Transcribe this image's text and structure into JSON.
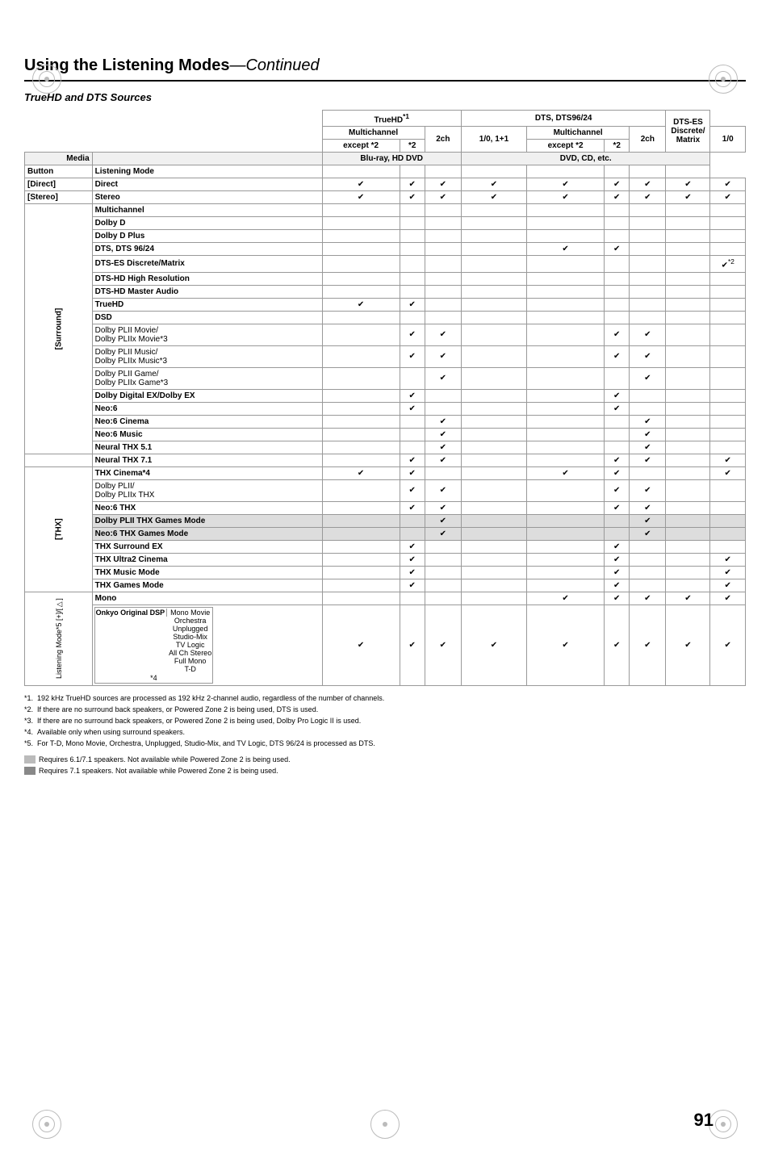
{
  "title": "Using the Listening Modes",
  "title_continued": "—Continued",
  "section_title": "TrueHD and DTS Sources",
  "page_number": "91",
  "table": {
    "col_groups": [
      {
        "label": "",
        "colspan": 2
      },
      {
        "label": "TrueHD*1",
        "colspan": 3
      },
      {
        "label": "DTS, DTS96/24",
        "colspan": 4
      },
      {
        "label": "DTS-ES Discrete/ Matrix",
        "colspan": 1
      }
    ],
    "sub_col_groups": [
      {
        "label": "",
        "colspan": 2
      },
      {
        "label": "Multichannel",
        "colspan": 2
      },
      {
        "label": "2ch",
        "colspan": 1
      },
      {
        "label": "1/0, 1+1",
        "colspan": 1
      },
      {
        "label": "Multichannel",
        "colspan": 2
      },
      {
        "label": "2ch",
        "colspan": 1
      },
      {
        "label": "1/0",
        "colspan": 1
      },
      {
        "label": "",
        "colspan": 1
      }
    ],
    "sub_sub_cols": [
      {
        "label": "except *2"
      },
      {
        "label": "*2"
      },
      {
        "label": "2ch"
      },
      {
        "label": "1/0, 1+1"
      },
      {
        "label": "except *2"
      },
      {
        "label": "*2"
      },
      {
        "label": "2ch"
      },
      {
        "label": "1/0"
      },
      {
        "label": ""
      }
    ],
    "media_row": [
      {
        "label": "Media",
        "align": "right"
      },
      {
        "label": "Blu-ray, HD DVD",
        "colspan": 3
      },
      {
        "label": "DVD, CD, etc.",
        "colspan": 5
      }
    ],
    "header_row": [
      {
        "label": "Button"
      },
      {
        "label": "Listening Mode"
      }
    ],
    "rows": [
      {
        "button": "[Direct]",
        "mode": "Direct",
        "group": "",
        "checks": [
          "✔",
          "✔",
          "✔",
          "✔",
          "✔",
          "✔",
          "✔",
          "✔",
          "✔"
        ]
      },
      {
        "button": "[Stereo]",
        "mode": "Stereo",
        "group": "",
        "checks": [
          "✔",
          "✔",
          "✔",
          "✔",
          "✔",
          "✔",
          "✔",
          "✔",
          "✔"
        ]
      },
      {
        "button": "",
        "mode": "Multichannel",
        "group": "[Surround]",
        "checks": [
          "",
          "",
          "",
          "",
          "",
          "",
          "",
          "",
          ""
        ]
      },
      {
        "button": "",
        "mode": "Dolby D",
        "group": "",
        "checks": [
          "",
          "",
          "",
          "",
          "",
          "",
          "",
          "",
          ""
        ]
      },
      {
        "button": "",
        "mode": "Dolby D Plus",
        "group": "",
        "checks": [
          "",
          "",
          "",
          "",
          "",
          "",
          "",
          "",
          ""
        ]
      },
      {
        "button": "",
        "mode": "DTS, DTS 96/24",
        "group": "",
        "checks": [
          "",
          "",
          "",
          "",
          "✔",
          "✔",
          "",
          "",
          ""
        ]
      },
      {
        "button": "",
        "mode": "DTS-ES Discrete/Matrix",
        "group": "",
        "checks": [
          "",
          "",
          "",
          "",
          "",
          "",
          "",
          "",
          "✔*2"
        ]
      },
      {
        "button": "",
        "mode": "DTS-HD High Resolution",
        "group": "",
        "checks": [
          "",
          "",
          "",
          "",
          "",
          "",
          "",
          "",
          ""
        ]
      },
      {
        "button": "",
        "mode": "DTS-HD Master Audio",
        "group": "",
        "checks": [
          "",
          "",
          "",
          "",
          "",
          "",
          "",
          "",
          ""
        ]
      },
      {
        "button": "",
        "mode": "TrueHD",
        "group": "",
        "checks": [
          "✔",
          "✔",
          "",
          "",
          "",
          "",
          "",
          "",
          ""
        ]
      },
      {
        "button": "",
        "mode": "DSD",
        "group": "",
        "checks": [
          "",
          "",
          "",
          "",
          "",
          "",
          "",
          "",
          ""
        ]
      },
      {
        "button": "",
        "mode": "Dolby PLII Movie/ Dolby PLIIx Movie*3",
        "group": "",
        "checks": [
          "",
          "✔",
          "✔",
          "",
          "",
          "✔",
          "✔",
          "",
          ""
        ]
      },
      {
        "button": "",
        "mode": "Dolby PLII Music/ Dolby PLIIx Music*3",
        "group": "",
        "checks": [
          "",
          "✔",
          "✔",
          "",
          "",
          "✔",
          "✔",
          "",
          ""
        ]
      },
      {
        "button": "",
        "mode": "Dolby PLII Game/ Dolby PLIIx Game*3",
        "group": "",
        "checks": [
          "",
          "",
          "✔",
          "",
          "",
          "",
          "✔",
          "",
          ""
        ]
      },
      {
        "button": "",
        "mode": "Dolby Digital EX/Dolby EX",
        "group": "",
        "checks": [
          "",
          "✔",
          "",
          "",
          "",
          "✔",
          "",
          "",
          ""
        ]
      },
      {
        "button": "",
        "mode": "Neo:6",
        "group": "",
        "checks": [
          "",
          "✔",
          "",
          "",
          "",
          "✔",
          "",
          "",
          ""
        ]
      },
      {
        "button": "",
        "mode": "Neo:6 Cinema",
        "group": "",
        "checks": [
          "",
          "",
          "✔",
          "",
          "",
          "",
          "✔",
          "",
          ""
        ]
      },
      {
        "button": "",
        "mode": "Neo:6 Music",
        "group": "",
        "checks": [
          "",
          "",
          "✔",
          "",
          "",
          "",
          "✔",
          "",
          ""
        ]
      },
      {
        "button": "",
        "mode": "Neural THX 5.1",
        "group": "",
        "checks": [
          "",
          "",
          "✔",
          "",
          "",
          "",
          "✔",
          "",
          ""
        ]
      },
      {
        "button": "",
        "mode": "Neural THX 7.1",
        "group": "",
        "checks": [
          "",
          "✔",
          "✔",
          "",
          "",
          "✔",
          "✔",
          "",
          "✔"
        ]
      },
      {
        "button": "",
        "mode": "THX Cinema*4",
        "group": "[THX]",
        "checks": [
          "✔",
          "✔",
          "",
          "",
          "✔",
          "✔",
          "",
          "",
          "✔"
        ]
      },
      {
        "button": "",
        "mode": "Dolby PLII/ Dolby PLIIx THX",
        "group": "",
        "checks": [
          "",
          "✔",
          "✔",
          "",
          "",
          "✔",
          "✔",
          "",
          ""
        ]
      },
      {
        "button": "",
        "mode": "Neo:6 THX",
        "group": "",
        "checks": [
          "",
          "✔",
          "✔",
          "",
          "",
          "✔",
          "✔",
          "",
          ""
        ]
      },
      {
        "button": "",
        "mode": "Dolby PLII THX Games Mode",
        "group": "",
        "checks": [
          "",
          "",
          "✔",
          "",
          "",
          "",
          "✔",
          "",
          ""
        ]
      },
      {
        "button": "",
        "mode": "Neo:6 THX Games Mode",
        "group": "",
        "checks": [
          "",
          "",
          "✔",
          "",
          "",
          "",
          "✔",
          "",
          ""
        ]
      },
      {
        "button": "",
        "mode": "THX Surround EX",
        "group": "",
        "checks": [
          "",
          "✔",
          "",
          "",
          "",
          "✔",
          "",
          "",
          ""
        ]
      },
      {
        "button": "",
        "mode": "THX Ultra2 Cinema",
        "group": "",
        "checks": [
          "",
          "✔",
          "",
          "",
          "",
          "✔",
          "",
          "",
          "✔"
        ]
      },
      {
        "button": "",
        "mode": "THX Music Mode",
        "group": "",
        "checks": [
          "",
          "✔",
          "",
          "",
          "",
          "✔",
          "",
          "",
          "✔"
        ]
      },
      {
        "button": "",
        "mode": "THX Games Mode",
        "group": "",
        "checks": [
          "",
          "✔",
          "",
          "",
          "",
          "✔",
          "",
          "",
          "✔"
        ]
      },
      {
        "button": "",
        "mode": "Mono",
        "group": "Listening Mode*5 [+]/[▷]",
        "checks": [
          "",
          "",
          "",
          "",
          "✔",
          "✔",
          "✔",
          "✔",
          "✔"
        ]
      },
      {
        "button": "",
        "mode": "Mono Movie / Orchestra / Unplugged / Studio-Mix / TV Logic / All Ch Stereo / Full Mono / T-D",
        "group": "",
        "checks": [
          "✔",
          "✔",
          "✔",
          "✔",
          "✔",
          "✔",
          "✔",
          "✔",
          "✔"
        ]
      }
    ]
  },
  "footnotes": [
    "*1.  192 kHz TrueHD sources are processed as 192 kHz 2-channel audio, regardless of the number of channels.",
    "*2.  If there are no surround back speakers, or Powered Zone 2 is being used, DTS is used.",
    "*3.  If there are no surround back speakers, or Powered Zone 2 is being used, Dolby Pro Logic II is used.",
    "*4.  Available only when using surround speakers.",
    "*5.  For T-D, Mono Movie, Orchestra, Unplugged, Studio-Mix, and TV Logic, DTS 96/24 is processed as DTS."
  ],
  "legend": [
    {
      "color": "gray",
      "text": "Requires 6.1/7.1 speakers. Not available while Powered Zone 2 is being used."
    },
    {
      "color": "dark",
      "text": "Requires 7.1 speakers. Not available while Powered Zone 2 is being used."
    }
  ]
}
